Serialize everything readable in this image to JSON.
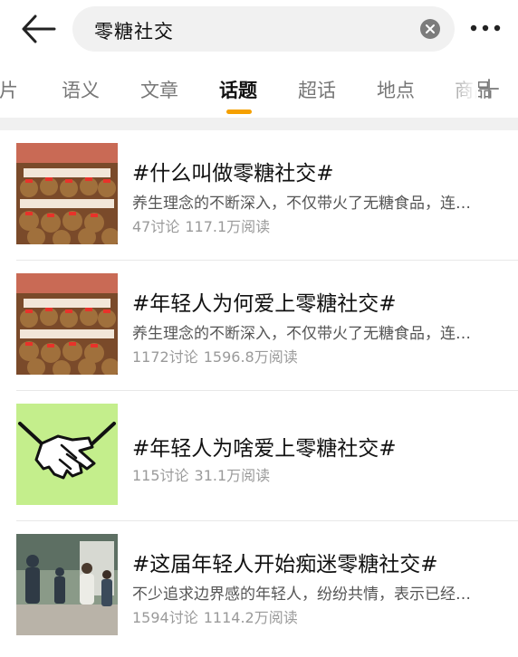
{
  "search": {
    "query": "零糖社交"
  },
  "tabs": [
    {
      "label": "图片"
    },
    {
      "label": "语义"
    },
    {
      "label": "文章"
    },
    {
      "label": "话题"
    },
    {
      "label": "超话"
    },
    {
      "label": "地点"
    },
    {
      "label": "商品"
    }
  ],
  "colors": {
    "accent": "#f5a000",
    "thumb_green": "#c4ee8c"
  },
  "icons": [
    "back-arrow-icon",
    "clear-icon",
    "more-icon",
    "add-icon"
  ],
  "topics": [
    {
      "title": "#什么叫做零糖社交#",
      "desc": "养生理念的不断深入，不仅带火了无糖食品，连…",
      "discussions": "47讨论",
      "reads": "117.1万阅读"
    },
    {
      "title": "#年轻人为何爱上零糖社交#",
      "desc": "养生理念的不断深入，不仅带火了无糖食品，连…",
      "discussions": "1172讨论",
      "reads": "1596.8万阅读"
    },
    {
      "title": "#年轻人为啥爱上零糖社交#",
      "desc": "",
      "discussions": "115讨论",
      "reads": "31.1万阅读"
    },
    {
      "title": "#这届年轻人开始痴迷零糖社交#",
      "desc": "不少追求边界感的年轻人，纷纷共情，表示已经…",
      "discussions": "1594讨论",
      "reads": "1114.2万阅读"
    }
  ]
}
